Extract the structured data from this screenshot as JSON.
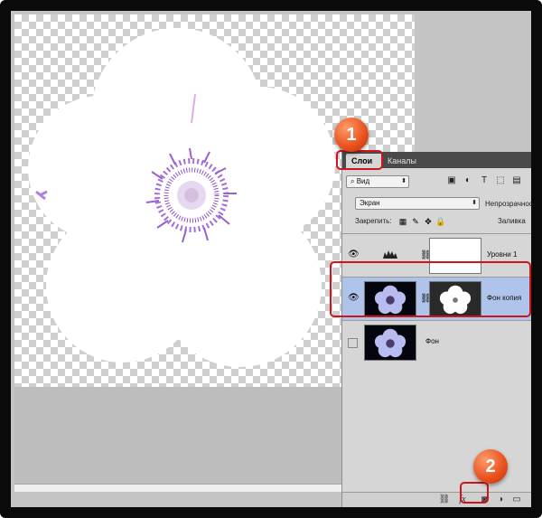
{
  "layers_panel": {
    "tabs": {
      "layers": "Слои",
      "channels": "Каналы"
    },
    "filter": {
      "kind": "Вид"
    },
    "blend_mode": "Экран",
    "opacity_label": "Непрозрачность:",
    "lock_label": "Закрепить:",
    "fill_label": "Заливка",
    "layers": [
      {
        "name": "Уровни 1",
        "visible": true,
        "selected": false
      },
      {
        "name": "Фон копия",
        "visible": true,
        "selected": true
      },
      {
        "name": "Фон",
        "visible": false,
        "selected": false
      }
    ]
  },
  "callouts": {
    "one": "1",
    "two": "2"
  },
  "colors": {
    "selection": "#aec4ea",
    "callout": "#e84f1c",
    "highlight": "#d0141c"
  }
}
